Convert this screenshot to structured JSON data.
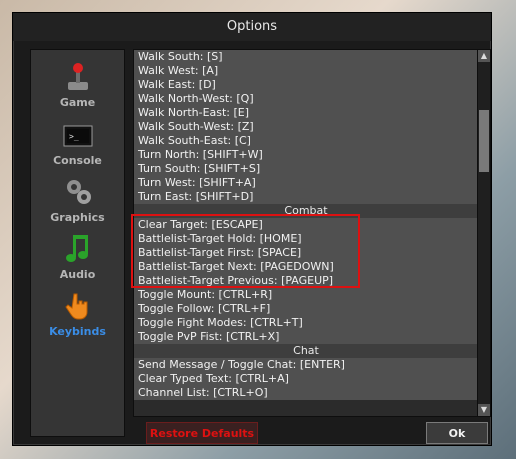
{
  "window": {
    "title": "Options"
  },
  "sidebar": {
    "items": [
      {
        "label": "Game",
        "icon": "joystick-icon"
      },
      {
        "label": "Console",
        "icon": "terminal-icon"
      },
      {
        "label": "Graphics",
        "icon": "gears-icon"
      },
      {
        "label": "Audio",
        "icon": "music-note-icon"
      },
      {
        "label": "Keybinds",
        "icon": "hand-pointer-icon",
        "active": true
      }
    ]
  },
  "keybinds": {
    "rows": [
      "Walk South:  [S]",
      "Walk West:  [A]",
      "Walk East:  [D]",
      "Walk North-West:  [Q]",
      "Walk North-East:  [E]",
      "Walk South-West:  [Z]",
      "Walk South-East:  [C]",
      "Turn North:  [SHIFT+W]",
      "Turn South:  [SHIFT+S]",
      "Turn West:  [SHIFT+A]",
      "Turn East:  [SHIFT+D]",
      "Combat",
      "Clear Target:  [ESCAPE]",
      "Battlelist-Target Hold:  [HOME]",
      "Battlelist-Target First:  [SPACE]",
      "Battlelist-Target Next:  [PAGEDOWN]",
      "Battlelist-Target Previous:  [PAGEUP]",
      "Toggle Mount:  [CTRL+R]",
      "Toggle Follow:  [CTRL+F]",
      "Toggle Fight Modes:  [CTRL+T]",
      "Toggle PvP Fist:  [CTRL+X]",
      "Chat",
      "Send Message / Toggle Chat:  [ENTER]",
      "Clear Typed Text:  [CTRL+A]",
      "Channel List:  [CTRL+O]"
    ],
    "header_rows": [
      11,
      21
    ]
  },
  "buttons": {
    "restore_label": "Restore Defaults",
    "ok_label": "Ok"
  },
  "colors": {
    "highlight": "#d11111",
    "active_label": "#3a8de6"
  }
}
